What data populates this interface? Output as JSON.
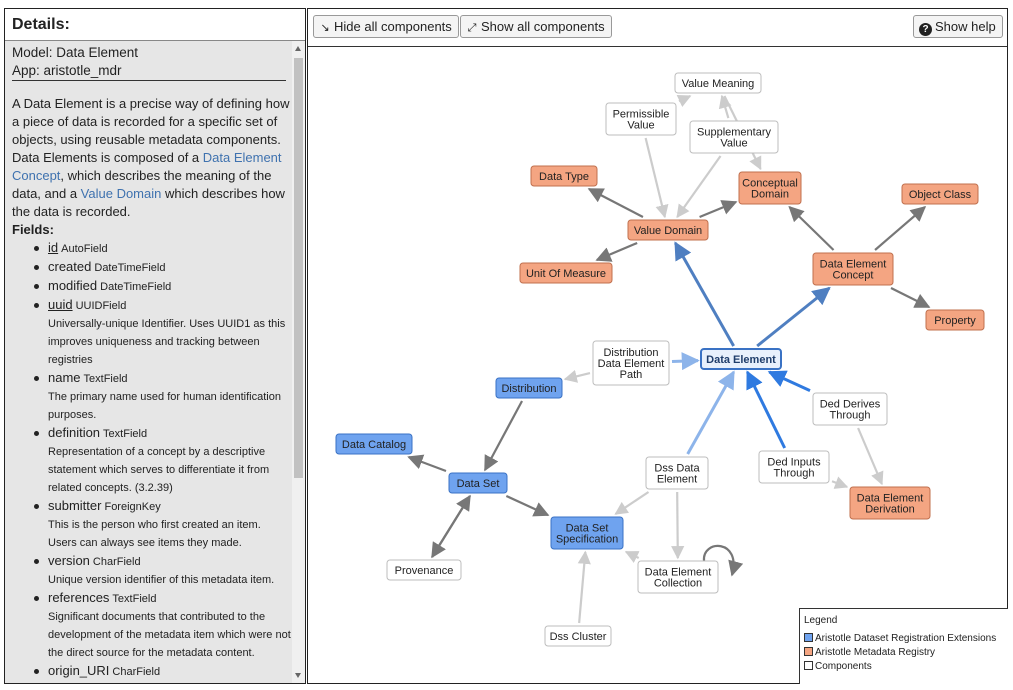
{
  "details": {
    "title": "Details:",
    "model_line": "Model: Data Element",
    "app_line": "App: aristotle_mdr",
    "description": {
      "part1": "A Data Element is a precise way of defining how a piece of data is recorded for a specific set of objects, using reusable metadata components. Data Elements is composed of a ",
      "link1": "Data Element Concept",
      "part2": ", which describes the meaning of the data, and a ",
      "link2": "Value Domain",
      "part3": " which describes how the data is recorded."
    },
    "fields_title": "Fields:",
    "fields": [
      {
        "name": "id",
        "type": "AutoField",
        "desc": ""
      },
      {
        "name": "created",
        "type": "DateTimeField",
        "desc": ""
      },
      {
        "name": "modified",
        "type": "DateTimeField",
        "desc": ""
      },
      {
        "name": "uuid",
        "type": "UUIDField",
        "desc": "Universally-unique Identifier. Uses UUID1 as this improves uniqueness and tracking between registries"
      },
      {
        "name": "name",
        "type": "TextField",
        "desc": "The primary name used for human identification purposes."
      },
      {
        "name": "definition",
        "type": "TextField",
        "desc": "Representation of a concept by a descriptive statement which serves to differentiate it from related concepts. (3.2.39)"
      },
      {
        "name": "submitter",
        "type": "ForeignKey",
        "desc": "This is the person who first created an item. Users can always see items they made."
      },
      {
        "name": "version",
        "type": "CharField",
        "desc": "Unique version identifier of this metadata item."
      },
      {
        "name": "references",
        "type": "TextField",
        "desc": "Significant documents that contributed to the development of the metadata item which were not the direct source for the metadata content."
      },
      {
        "name": "origin_URI",
        "type": "CharField",
        "desc": ""
      }
    ]
  },
  "toolbar": {
    "hide_label": "Hide all components",
    "show_label": "Show all components",
    "help_label": "Show help",
    "hide_icon": "compress-icon",
    "show_icon": "expand-icon",
    "help_icon": "question-circle-icon"
  },
  "graph": {
    "nodes": [
      {
        "id": "value_meaning",
        "label": [
          "Value Meaning"
        ],
        "group": "component"
      },
      {
        "id": "permissible_value",
        "label": [
          "Permissible",
          "Value"
        ],
        "group": "component"
      },
      {
        "id": "supplementary_value",
        "label": [
          "Supplementary",
          "Value"
        ],
        "group": "component"
      },
      {
        "id": "data_type",
        "label": [
          "Data Type"
        ],
        "group": "mdr"
      },
      {
        "id": "conceptual_domain",
        "label": [
          "Conceptual",
          "Domain"
        ],
        "group": "mdr"
      },
      {
        "id": "object_class",
        "label": [
          "Object Class"
        ],
        "group": "mdr"
      },
      {
        "id": "value_domain",
        "label": [
          "Value Domain"
        ],
        "group": "mdr"
      },
      {
        "id": "unit_of_measure",
        "label": [
          "Unit Of Measure"
        ],
        "group": "mdr"
      },
      {
        "id": "data_element_concept",
        "label": [
          "Data Element",
          "Concept"
        ],
        "group": "mdr"
      },
      {
        "id": "property",
        "label": [
          "Property"
        ],
        "group": "mdr"
      },
      {
        "id": "distribution_data_element_path",
        "label": [
          "Distribution",
          "Data Element",
          "Path"
        ],
        "group": "component"
      },
      {
        "id": "data_element",
        "label": [
          "Data Element"
        ],
        "group": "focus"
      },
      {
        "id": "distribution",
        "label": [
          "Distribution"
        ],
        "group": "dataset"
      },
      {
        "id": "ded_derives_through",
        "label": [
          "Ded Derives",
          "Through"
        ],
        "group": "component"
      },
      {
        "id": "data_catalog",
        "label": [
          "Data Catalog"
        ],
        "group": "dataset"
      },
      {
        "id": "dss_data_element",
        "label": [
          "Dss Data",
          "Element"
        ],
        "group": "component"
      },
      {
        "id": "ded_inputs_through",
        "label": [
          "Ded Inputs",
          "Through"
        ],
        "group": "component"
      },
      {
        "id": "data_set",
        "label": [
          "Data Set"
        ],
        "group": "dataset"
      },
      {
        "id": "data_element_derivation",
        "label": [
          "Data Element",
          "Derivation"
        ],
        "group": "mdr"
      },
      {
        "id": "data_set_specification",
        "label": [
          "Data Set",
          "Specification"
        ],
        "group": "dataset"
      },
      {
        "id": "provenance",
        "label": [
          "Provenance"
        ],
        "group": "component"
      },
      {
        "id": "data_element_collection",
        "label": [
          "Data Element",
          "Collection"
        ],
        "group": "component"
      },
      {
        "id": "dss_cluster",
        "label": [
          "Dss Cluster"
        ],
        "group": "component"
      }
    ],
    "edges": [
      {
        "from": "permissible_value",
        "to": "value_meaning",
        "style": "light"
      },
      {
        "from": "permissible_value",
        "to": "value_domain",
        "style": "light"
      },
      {
        "from": "supplementary_value",
        "to": "value_meaning",
        "style": "light"
      },
      {
        "from": "supplementary_value",
        "to": "value_domain",
        "style": "light"
      },
      {
        "from": "value_meaning",
        "to": "conceptual_domain",
        "style": "light"
      },
      {
        "from": "value_domain",
        "to": "data_type",
        "style": "dark"
      },
      {
        "from": "value_domain",
        "to": "conceptual_domain",
        "style": "dark"
      },
      {
        "from": "value_domain",
        "to": "unit_of_measure",
        "style": "dark"
      },
      {
        "from": "data_element_concept",
        "to": "conceptual_domain",
        "style": "dark"
      },
      {
        "from": "data_element_concept",
        "to": "object_class",
        "style": "dark"
      },
      {
        "from": "data_element_concept",
        "to": "property",
        "style": "dark"
      },
      {
        "from": "data_element",
        "to": "value_domain",
        "style": "blue"
      },
      {
        "from": "data_element",
        "to": "data_element_concept",
        "style": "blue"
      },
      {
        "from": "distribution_data_element_path",
        "to": "data_element",
        "style": "lightblue"
      },
      {
        "from": "distribution_data_element_path",
        "to": "distribution",
        "style": "light"
      },
      {
        "from": "ded_derives_through",
        "to": "data_element",
        "style": "bright"
      },
      {
        "from": "ded_derives_through",
        "to": "data_element_derivation",
        "style": "light"
      },
      {
        "from": "ded_inputs_through",
        "to": "data_element",
        "style": "bright"
      },
      {
        "from": "ded_inputs_through",
        "to": "data_element_derivation",
        "style": "light"
      },
      {
        "from": "dss_data_element",
        "to": "data_element",
        "style": "lightblue"
      },
      {
        "from": "dss_data_element",
        "to": "data_set_specification",
        "style": "light"
      },
      {
        "from": "dss_data_element",
        "to": "data_element_collection",
        "style": "light"
      },
      {
        "from": "distribution",
        "to": "data_set",
        "style": "dark"
      },
      {
        "from": "data_set",
        "to": "data_catalog",
        "style": "dark"
      },
      {
        "from": "data_set",
        "to": "provenance",
        "style": "dark"
      },
      {
        "from": "provenance",
        "to": "data_set",
        "style": "dark"
      },
      {
        "from": "data_set",
        "to": "data_set_specification",
        "style": "dark"
      },
      {
        "from": "data_element_collection",
        "to": "data_set_specification",
        "style": "light"
      },
      {
        "from": "dss_cluster",
        "to": "data_set_specification",
        "style": "light"
      },
      {
        "from": "data_element_collection",
        "to": "data_element_collection",
        "style": "self"
      }
    ]
  },
  "legend": {
    "title": "Legend",
    "items": [
      {
        "label": "Aristotle Dataset Registration Extensions",
        "color": "#6fa3ef"
      },
      {
        "label": "Aristotle Metadata Registry",
        "color": "#f4a582"
      },
      {
        "label": "Components",
        "color": "#ffffff"
      }
    ]
  },
  "colors": {
    "dataset_fill": "#6fa3ef",
    "dataset_border": "#3a72c4",
    "mdr_fill": "#f4a582",
    "mdr_border": "#c0704e",
    "focus_fill": "#e8f0fc",
    "focus_border": "#3a72c4",
    "component_fill": "#ffffff",
    "component_border": "#bdbdbd",
    "edge_dark": "#777777",
    "edge_light": "#cccccc",
    "edge_blue": "#4f7fc1",
    "edge_bright": "#2f7ae0",
    "edge_lightblue": "#8db4ea"
  }
}
